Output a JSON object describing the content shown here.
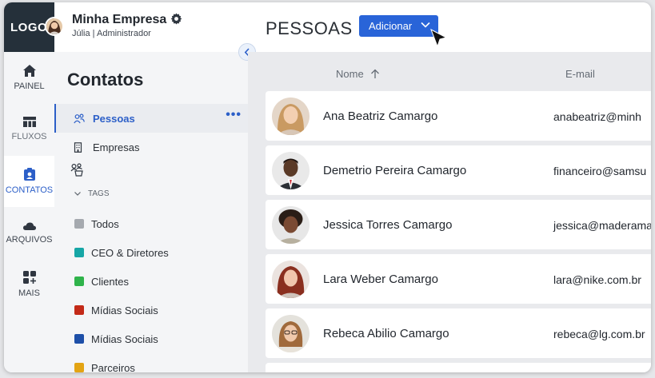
{
  "app": {
    "logo_text": "LOGO",
    "company": "Minha Empresa",
    "user_line": "Júlia | Administrador"
  },
  "rail": [
    {
      "label": "PAINEL",
      "icon": "home-icon"
    },
    {
      "label": "FLUXOS",
      "icon": "table-icon"
    },
    {
      "label": "CONTATOS",
      "icon": "contact-card-icon"
    },
    {
      "label": "ARQUIVOS",
      "icon": "cloud-icon"
    },
    {
      "label": "MAIS",
      "icon": "grid-plus-icon"
    }
  ],
  "header": {
    "title": "PESSOAS",
    "add_label": "Adicionar"
  },
  "sidebar": {
    "title": "Contatos",
    "nav": [
      {
        "label": "Pessoas",
        "icon": "people-icon"
      },
      {
        "label": "Empresas",
        "icon": "building-icon"
      }
    ],
    "more_menu": "•••",
    "tags_label": "TAGS",
    "tags": [
      {
        "label": "Todos",
        "color": "#a5a9af"
      },
      {
        "label": "CEO & Diretores",
        "color": "#16a6a6"
      },
      {
        "label": "Clientes",
        "color": "#2fb34b"
      },
      {
        "label": "Mídias Sociais",
        "color": "#c32a18"
      },
      {
        "label": "Mídias Sociais",
        "color": "#1d4fa8"
      },
      {
        "label": "Parceiros",
        "color": "#e3a414"
      }
    ]
  },
  "table": {
    "columns": {
      "name": "Nome",
      "email": "E-mail"
    },
    "rows": [
      {
        "name": "Ana Beatriz Camargo",
        "email": "anabeatriz@minh"
      },
      {
        "name": "Demetrio Pereira Camargo",
        "email": "financeiro@samsu"
      },
      {
        "name": "Jessica Torres Camargo",
        "email": "jessica@maderama"
      },
      {
        "name": "Lara Weber Camargo",
        "email": "lara@nike.com.br"
      },
      {
        "name": "Rebeca Abilio Camargo",
        "email": "rebeca@lg.com.br"
      }
    ]
  },
  "colors": {
    "accent": "#2964d8",
    "logo_bg": "#25303a"
  }
}
